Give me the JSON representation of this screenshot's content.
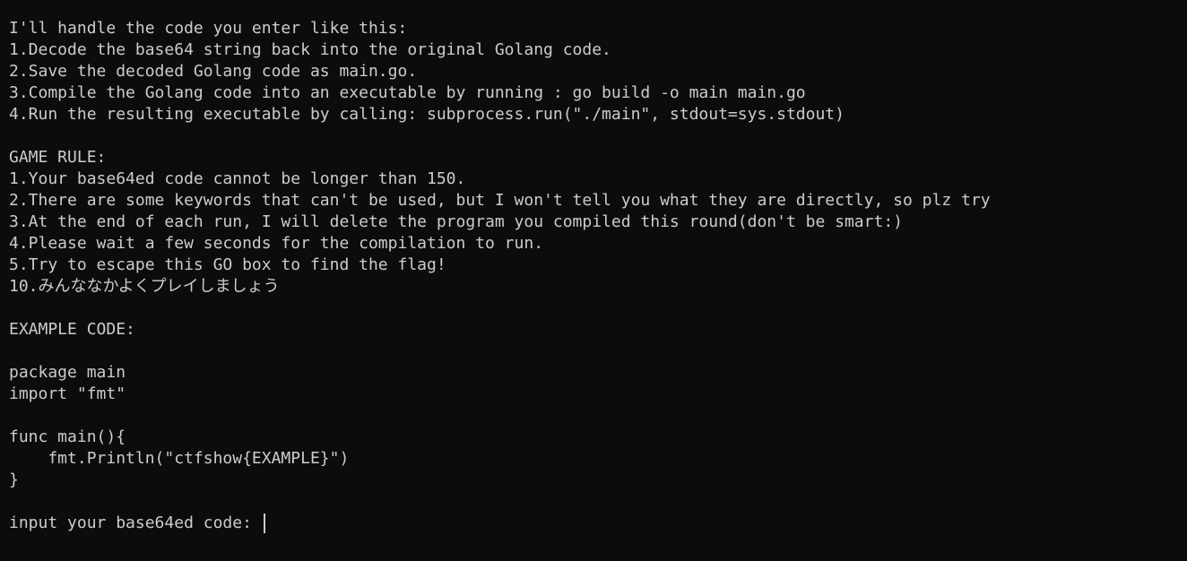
{
  "terminal": {
    "intro": {
      "heading": "I'll handle the code you enter like this:",
      "steps": [
        "1.Decode the base64 string back into the original Golang code.",
        "2.Save the decoded Golang code as main.go.",
        "3.Compile the Golang code into an executable by running : go build -o main main.go",
        "4.Run the resulting executable by calling: subprocess.run(\"./main\", stdout=sys.stdout)"
      ]
    },
    "rules": {
      "heading": "GAME RULE:",
      "items": [
        "1.Your base64ed code cannot be longer than 150.",
        "2.There are some keywords that can't be used, but I won't tell you what they are directly, so plz try",
        "3.At the end of each run, I will delete the program you compiled this round(don't be smart:)",
        "4.Please wait a few seconds for the compilation to run.",
        "5.Try to escape this GO box to find the flag!",
        "10.みんななかよくプレイしましょう"
      ]
    },
    "example": {
      "heading": "EXAMPLE CODE:",
      "code": [
        "package main",
        "import \"fmt\"",
        "",
        "func main(){",
        "    fmt.Println(\"ctfshow{EXAMPLE}\")",
        "}"
      ]
    },
    "prompt": {
      "label": "input your base64ed code: ",
      "value": ""
    }
  },
  "colors": {
    "background": "#0c0c0c",
    "text": "#cccccc"
  }
}
